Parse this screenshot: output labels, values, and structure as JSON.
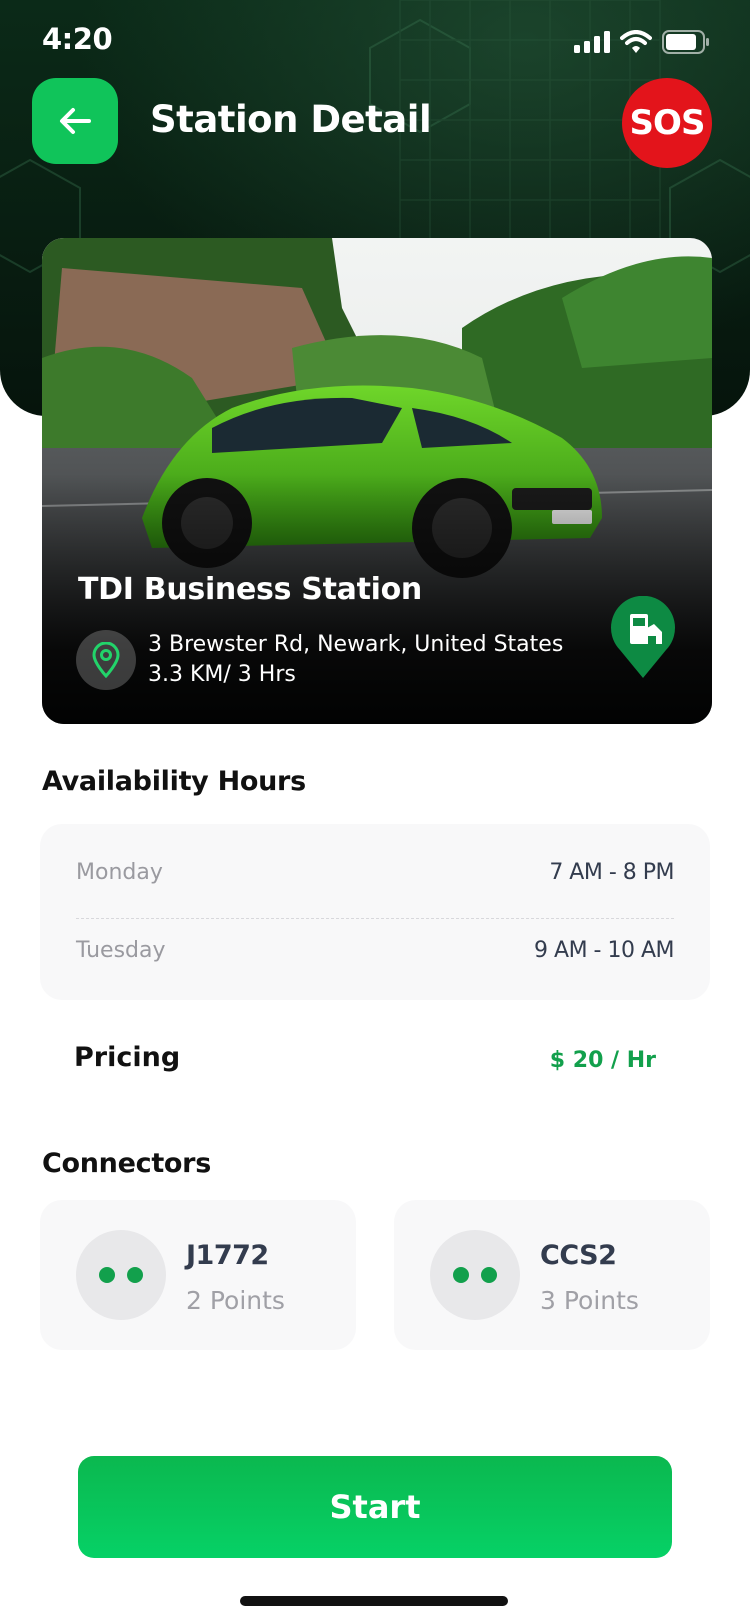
{
  "status_bar": {
    "time": "4:20",
    "icons": [
      "signal-icon",
      "wifi-icon",
      "battery-icon"
    ]
  },
  "header": {
    "title": "Station Detail",
    "back_icon": "arrow-left-icon",
    "sos_label": "SOS"
  },
  "station": {
    "name": "TDI Business Station",
    "address": "3 Brewster Rd, Newark, United States",
    "distance": "3.3 KM/ 3 Hrs",
    "location_icon": "map-pin-icon",
    "type_icon": "ev-station-pin-icon"
  },
  "availability": {
    "title": "Availability Hours",
    "rows": [
      {
        "day": "Monday",
        "hours": "7 AM - 8 PM"
      },
      {
        "day": "Tuesday",
        "hours": "9 AM - 10 AM"
      }
    ]
  },
  "pricing": {
    "label": "Pricing",
    "value": "$ 20 / Hr"
  },
  "connectors": {
    "title": "Connectors",
    "items": [
      {
        "name": "J1772",
        "points": "2 Points",
        "icon": "plug-icon"
      },
      {
        "name": "CCS2",
        "points": "3 Points",
        "icon": "plug-icon"
      }
    ]
  },
  "actions": {
    "start_label": "Start"
  },
  "colors": {
    "brand_green": "#10c45a",
    "sos_red": "#e3141b",
    "price_green": "#12a04c",
    "header_dark": "#0b2a18"
  }
}
